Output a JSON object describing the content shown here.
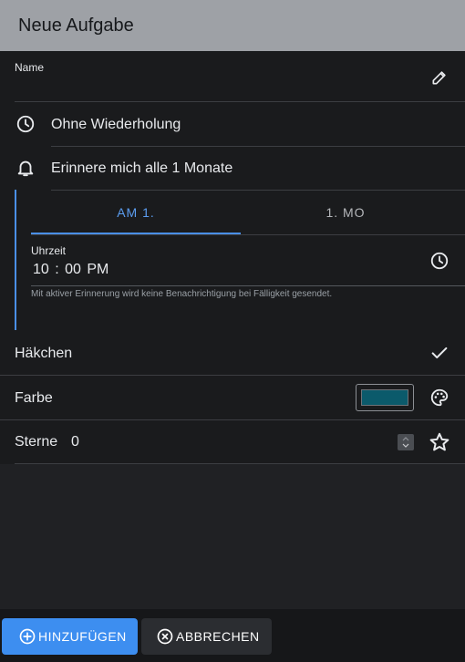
{
  "dialog": {
    "title": "Neue Aufgabe"
  },
  "name_field": {
    "label": "Name",
    "value": ""
  },
  "repeat": {
    "label": "Ohne Wiederholung"
  },
  "reminder": {
    "label": "Erinnere mich alle 1 Monate",
    "tabs": [
      "AM 1.",
      "1. MO"
    ],
    "active_tab": 0,
    "time_label": "Uhrzeit",
    "time_value": "10 : 00   PM",
    "hint": "Mit aktiver Erinnerung wird keine Benachrichtigung bei Fälligkeit gesendet."
  },
  "checkmark": {
    "label": "Häkchen"
  },
  "color": {
    "label": "Farbe",
    "value": "#0b5a6b"
  },
  "stars": {
    "label": "Sterne",
    "value": "0"
  },
  "buttons": {
    "add": "HINZUFÜGEN",
    "cancel": "ABBRECHEN"
  },
  "theme": {
    "accent": "#3d8ef0",
    "background": "#202124"
  }
}
